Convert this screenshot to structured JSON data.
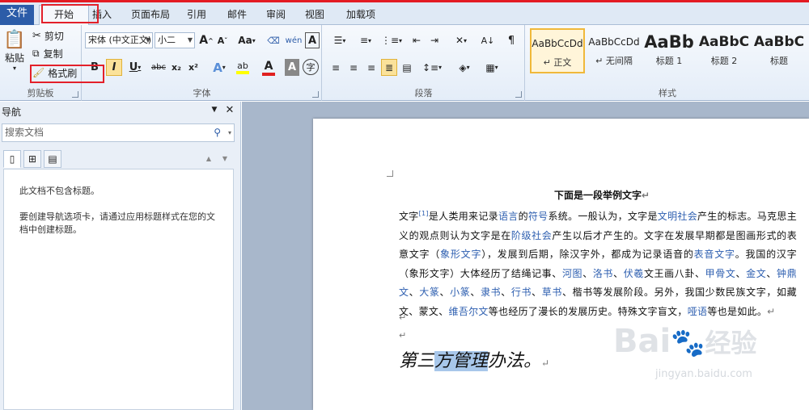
{
  "tabs": {
    "file": "文件",
    "home": "开始",
    "insert": "插入",
    "layout": "页面布局",
    "references": "引用",
    "mailings": "邮件",
    "review": "审阅",
    "view": "视图",
    "addins": "加载项"
  },
  "clipboard": {
    "paste": "粘贴",
    "cut": "剪切",
    "copy": "复制",
    "format_painter": "格式刷",
    "group_label": "剪贴板"
  },
  "font": {
    "font_name": "宋体 (中文正文)",
    "font_size": "小二",
    "group_label": "字体",
    "grow": "A",
    "shrink": "A",
    "case": "Aa",
    "bold": "B",
    "italic": "I",
    "underline": "U",
    "strike": "abc",
    "subscript": "x₂",
    "superscript": "x²",
    "text_effect": "A",
    "highlight": "ab",
    "font_color": "A",
    "char_shade": "A",
    "phonetic": "wén",
    "enclose": "字"
  },
  "paragraph": {
    "group_label": "段落"
  },
  "styles": {
    "group_label": "样式",
    "items": [
      {
        "preview": "AaBbCcDd",
        "name": "↵ 正文"
      },
      {
        "preview": "AaBbCcDd",
        "name": "↵ 无间隔"
      },
      {
        "preview": "AaBb",
        "name": "标题 1"
      },
      {
        "preview": "AaBbC",
        "name": "标题 2"
      },
      {
        "preview": "AaBbC",
        "name": "标题"
      }
    ]
  },
  "nav": {
    "title": "导航",
    "search_placeholder": "搜索文档",
    "msg1": "此文档不包含标题。",
    "msg2": "要创建导航选项卡，请通过应用标题样式在您的文档中创建标题。"
  },
  "doc": {
    "title": "下面是一段举例文字",
    "p": [
      "文字",
      "[1]",
      "是人类用来记录",
      "语言",
      "的",
      "符号",
      "系统。一般认为，文字是",
      "文明社会",
      "产生的标志。马克思主义的观点则认为文字是在",
      "阶级社会",
      "产生以后才产生的。文字在发展早期都是图画形式的表意文字（",
      "象形文字",
      "），发展到后期，除汉字外，都成为记录语音的",
      "表音文字",
      "。我国的汉字（象形文字）大体经历了结绳记事、",
      "河图",
      "、",
      "洛书",
      "、",
      "伏羲",
      "文王画八卦、",
      "甲骨文",
      "、",
      "金文",
      "、",
      "钟鼎文",
      "、",
      "大篆",
      "、",
      "小篆",
      "、",
      "隶书",
      "、",
      "行书",
      "、",
      "草书",
      "、楷书等发展阶段。另外，我国少数民族文字，如藏文、蒙文、",
      "维吾尔文",
      "等也经历了漫长的发展历史。特殊文字盲文，",
      "哑语",
      "等也是如此。"
    ],
    "big_pre": "第三",
    "big_sel": "方管理",
    "big_post": "办法。",
    "para_mark": "↵"
  },
  "watermark": {
    "brand": "Bai",
    "brand_cn": "经验",
    "url": "jingyan.baidu.com"
  }
}
